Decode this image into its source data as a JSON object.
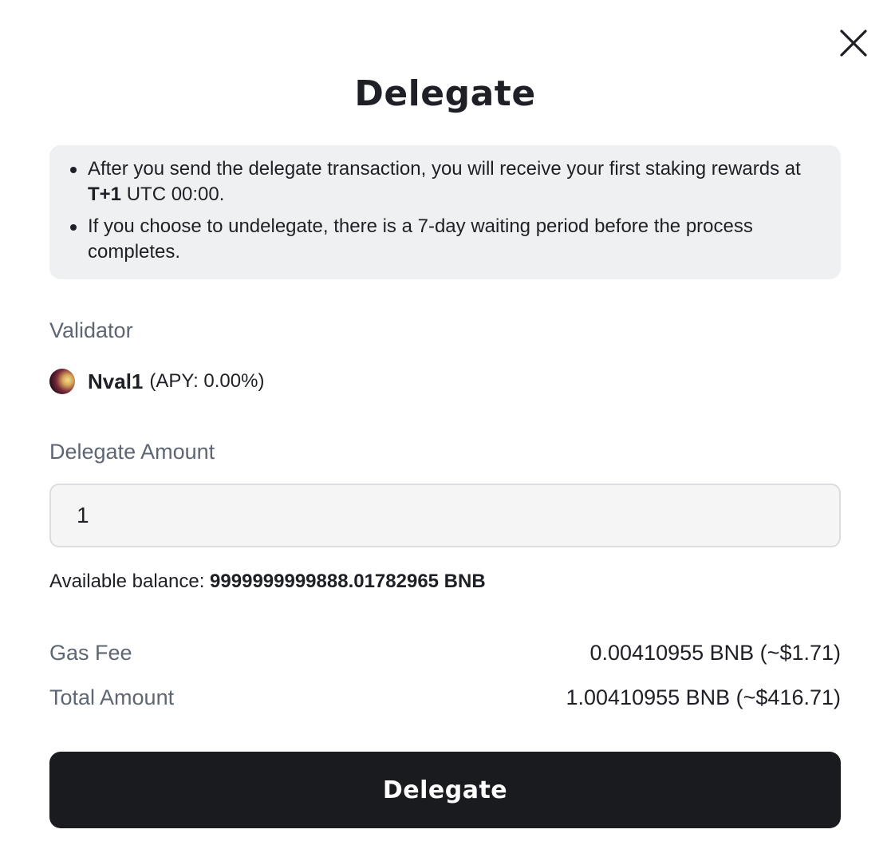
{
  "dialog": {
    "title": "Delegate",
    "close_icon": "close-icon"
  },
  "notice": {
    "item1_prefix": "After you send the delegate transaction, you will receive your first staking rewards at ",
    "item1_bold": "T+1",
    "item1_suffix": " UTC 00:00.",
    "item2": "If you choose to undelegate, there is a 7-day waiting period before the process completes."
  },
  "validator": {
    "label": "Validator",
    "name": "Nval1",
    "apy": "(APY: 0.00%)"
  },
  "amount": {
    "label": "Delegate Amount",
    "value": "1"
  },
  "balance": {
    "label": "Available balance: ",
    "value": "9999999999888.01782965 BNB"
  },
  "gas_fee": {
    "label": "Gas Fee",
    "value": "0.00410955 BNB (~$1.71)"
  },
  "total_amount": {
    "label": "Total Amount",
    "value": "1.00410955 BNB (~$416.71)"
  },
  "submit": {
    "label": "Delegate"
  },
  "colors": {
    "button_bg": "#1a1b1f",
    "notice_bg": "#eff0f2",
    "label_gray": "#5e6673",
    "text": "#1e2026"
  }
}
